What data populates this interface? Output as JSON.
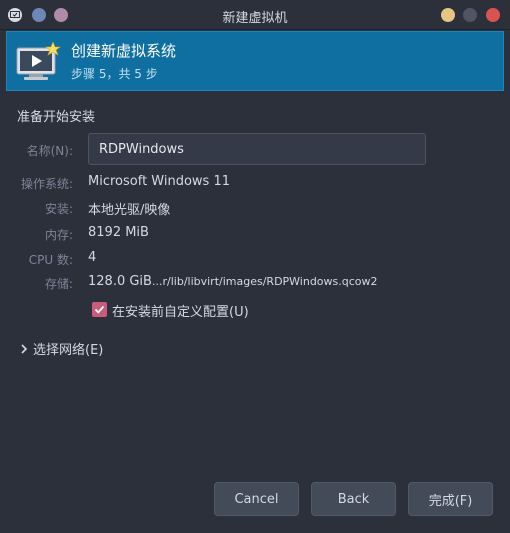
{
  "window": {
    "title": "新建虚拟机"
  },
  "banner": {
    "title": "创建新虚拟系统",
    "step": "步骤 5，共 5 步"
  },
  "section": {
    "title": "准备开始安装"
  },
  "fields": {
    "name_label": "名称(N):",
    "name_value": "RDPWindows",
    "os_label": "操作系统:",
    "os_value": "Microsoft Windows 11",
    "install_label": "安装:",
    "install_value": "本地光驱/映像",
    "memory_label": "内存:",
    "memory_value": "8192 MiB",
    "cpu_label": "CPU 数:",
    "cpu_value": "4",
    "storage_label": "存储:",
    "storage_size": "128.0 GiB",
    "storage_path": "...r/lib/libvirt/images/RDPWindows.qcow2"
  },
  "customize": {
    "label": "在安装前自定义配置(U)",
    "checked": true
  },
  "network": {
    "label": "选择网络(E)"
  },
  "buttons": {
    "cancel": "Cancel",
    "back": "Back",
    "finish": "完成(F)"
  },
  "colors": {
    "banner": "#0f6fa0",
    "checkbox": "#c95c7a",
    "background": "#2b303b"
  }
}
